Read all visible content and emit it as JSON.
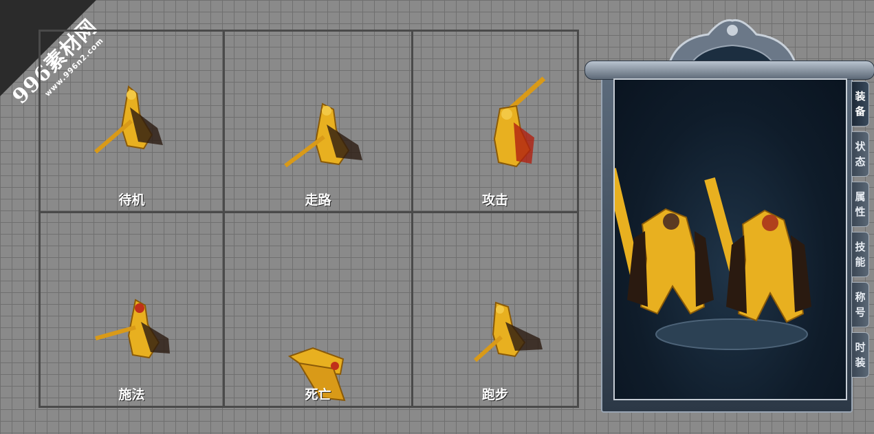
{
  "watermark": {
    "brand": "996素材网",
    "url": "www.996n2.com"
  },
  "animations": [
    {
      "label": "待机"
    },
    {
      "label": "走路"
    },
    {
      "label": "攻击"
    },
    {
      "label": "施法"
    },
    {
      "label": "死亡"
    },
    {
      "label": "跑步"
    }
  ],
  "panel": {
    "tabs": [
      {
        "line1": "装",
        "line2": "备"
      },
      {
        "line1": "状",
        "line2": "态"
      },
      {
        "line1": "属",
        "line2": "性"
      },
      {
        "line1": "技",
        "line2": "能"
      },
      {
        "line1": "称",
        "line2": "号"
      },
      {
        "line1": "时",
        "line2": "装"
      }
    ]
  },
  "colors": {
    "gold": "#e8b020",
    "gold_dark": "#8a5a08",
    "cape": "#2a1a10",
    "panel_bg": "#0f1c2a"
  }
}
